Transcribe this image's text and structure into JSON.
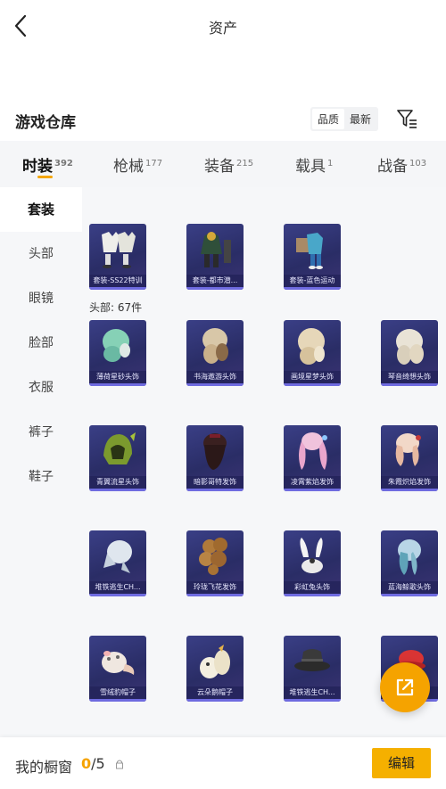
{
  "header": {
    "title": "资产"
  },
  "section": {
    "title": "游戏仓库",
    "sort_options": [
      "品质",
      "最新"
    ],
    "active_sort": "品质"
  },
  "tabs": [
    {
      "label": "时装",
      "count": "392"
    },
    {
      "label": "枪械",
      "count": "177"
    },
    {
      "label": "装备",
      "count": "215"
    },
    {
      "label": "载具",
      "count": "1"
    },
    {
      "label": "战备",
      "count": "103"
    }
  ],
  "sidebar": {
    "items": [
      "套装",
      "头部",
      "眼镜",
      "脸部",
      "衣服",
      "裤子",
      "鞋子"
    ]
  },
  "outfits": [
    {
      "name": "套装-SS22特训",
      "icon": "white-outfit-icon"
    },
    {
      "name": "套装-都市潜...",
      "icon": "hoodie-outfit-icon"
    },
    {
      "name": "套装-蓝色运动",
      "icon": "blue-sport-outfit-icon"
    }
  ],
  "head_count_label": "头部: 67件",
  "head_items": [
    {
      "name": "薄荷星砂头饰",
      "icon": "mint-hair-icon"
    },
    {
      "name": "书海遨游头饰",
      "icon": "beige-hair-icon"
    },
    {
      "name": "画境星梦头饰",
      "icon": "cream-hair-icon"
    },
    {
      "name": "琴音绮想头饰",
      "icon": "light-hair-icon"
    },
    {
      "name": "青翼流星头饰",
      "icon": "green-hood-icon"
    },
    {
      "name": "暗影哥特发饰",
      "icon": "dark-hair-icon"
    },
    {
      "name": "凌霄紫焰发饰",
      "icon": "pink-twintail-icon"
    },
    {
      "name": "朱霞炽焰发饰",
      "icon": "peach-hair-icon"
    },
    {
      "name": "堆铁逃生CH...",
      "icon": "silver-hair-icon"
    },
    {
      "name": "玲珑飞花发饰",
      "icon": "brown-curly-hair-icon"
    },
    {
      "name": "彩虹兔头饰",
      "icon": "bunny-ears-icon"
    },
    {
      "name": "蓝海鲸歌头饰",
      "icon": "teal-hair-icon"
    },
    {
      "name": "雪绒豹帽子",
      "icon": "snow-leopard-hat-icon"
    },
    {
      "name": "云朵鹅帽子",
      "icon": "goose-hat-icon"
    },
    {
      "name": "堆铁逃生CH...",
      "icon": "bucket-hat-icon"
    },
    {
      "name": "",
      "icon": "red-hat-icon"
    }
  ],
  "bottom": {
    "showcase_label": "我的橱窗",
    "showcase_current": "0",
    "showcase_total": "/5",
    "edit_label": "编辑"
  },
  "colors": {
    "accent": "#f5a600",
    "card_bg": "#2f3270",
    "edit_button": "#f5b000"
  }
}
